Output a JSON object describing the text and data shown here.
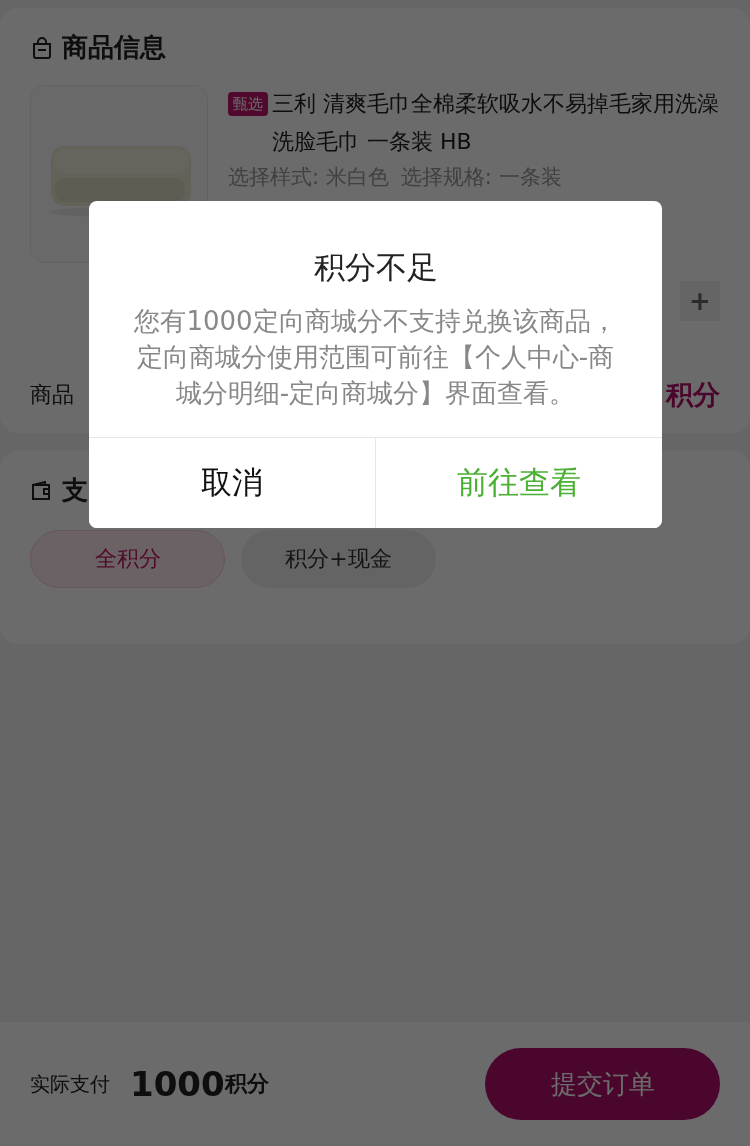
{
  "product_section": {
    "title": "商品信息",
    "product": {
      "tag": "甄选",
      "name": "三利 清爽毛巾全棉柔软吸水不易掉毛家用洗澡洗脸毛巾 一条装 HB",
      "specs": [
        "选择样式: 米白色",
        "选择规格: 一条装"
      ]
    },
    "stepper": {
      "increment": "+"
    },
    "total_row": {
      "label": "商品",
      "value": "积分"
    }
  },
  "payment_section": {
    "title": "支",
    "options": [
      {
        "label": "全积分",
        "selected": true
      },
      {
        "label": "积分+现金",
        "selected": false
      }
    ]
  },
  "bottom_bar": {
    "label": "实际支付",
    "amount": "1000",
    "unit": "积分",
    "submit": "提交订单"
  },
  "dialog": {
    "title": "积分不足",
    "message": "您有1000定向商城分不支持兑换该商品，定向商城分使用范围可前往【个人中心-商城分明细-定向商城分】界面查看。",
    "buttons": [
      {
        "label": "取消",
        "kind": "cancel"
      },
      {
        "label": "前往查看",
        "kind": "confirm"
      }
    ]
  }
}
